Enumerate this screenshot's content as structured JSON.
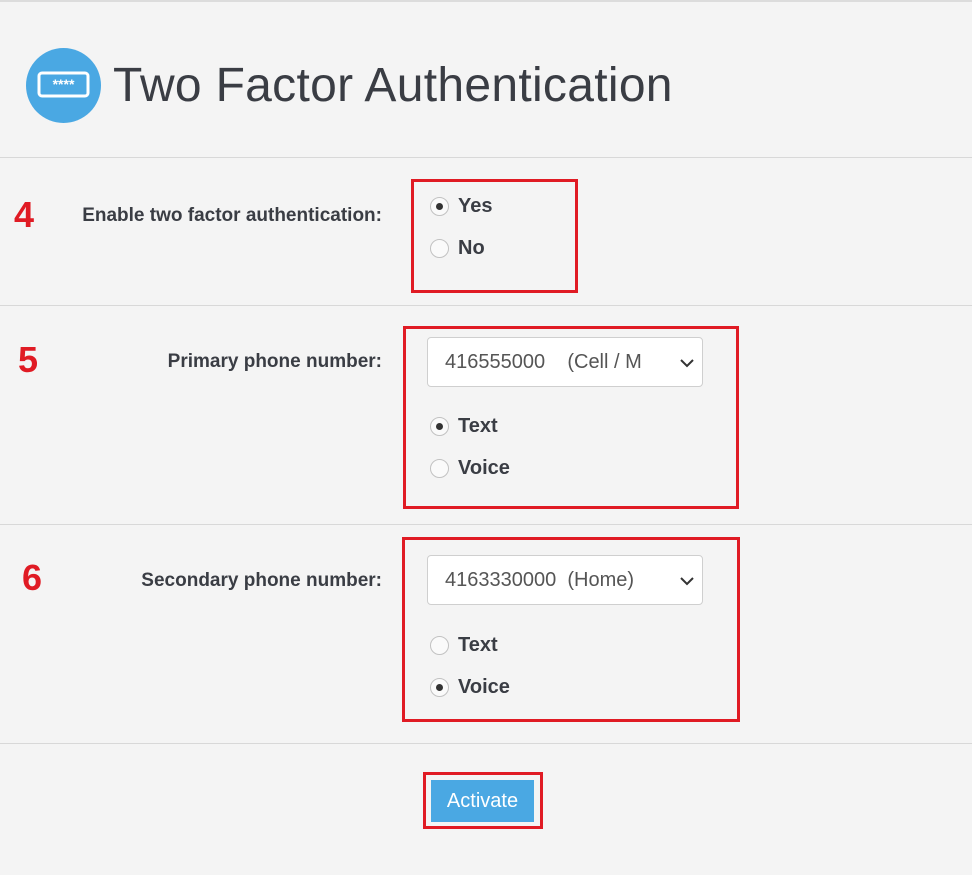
{
  "header": {
    "title": "Two Factor Authentication",
    "icon": "password-field-icon",
    "icon_color": "#4aa8e3"
  },
  "steps": {
    "enable": "4",
    "primary": "5",
    "secondary": "6"
  },
  "enable_2fa": {
    "label": "Enable two factor authentication:",
    "options": [
      {
        "label": "Yes",
        "checked": true
      },
      {
        "label": "No",
        "checked": false
      }
    ]
  },
  "primary_phone": {
    "label": "Primary phone number:",
    "selected": "416555000    (Cell / M",
    "methods": [
      {
        "label": "Text",
        "checked": true
      },
      {
        "label": "Voice",
        "checked": false
      }
    ]
  },
  "secondary_phone": {
    "label": "Secondary phone number:",
    "selected": "4163330000  (Home)",
    "methods": [
      {
        "label": "Text",
        "checked": false
      },
      {
        "label": "Voice",
        "checked": true
      }
    ]
  },
  "actions": {
    "activate_label": "Activate"
  },
  "colors": {
    "accent": "#4aa8e3",
    "highlight": "#e01b24",
    "background": "#f4f4f4"
  }
}
